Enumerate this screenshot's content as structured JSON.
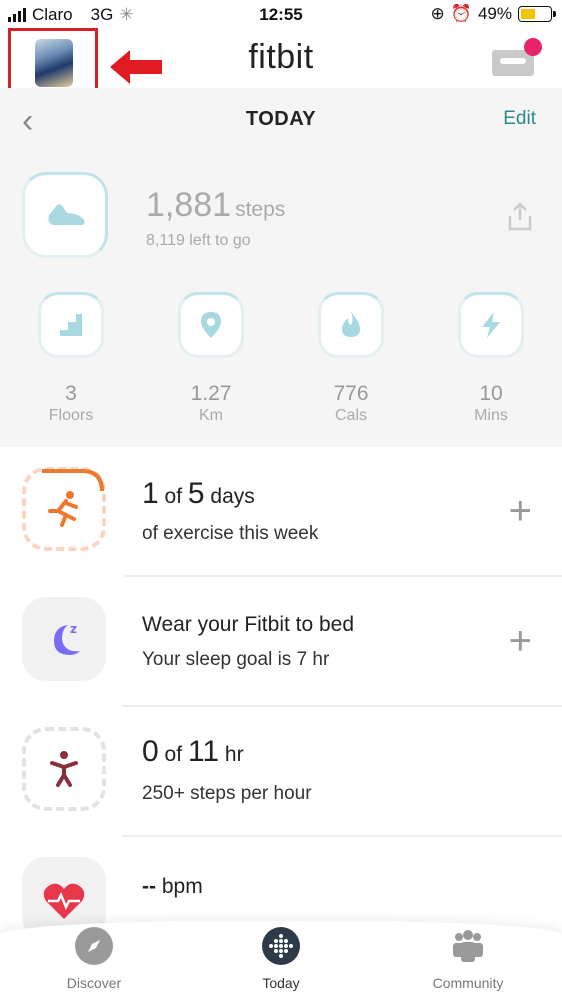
{
  "status_bar": {
    "carrier": "Claro",
    "network": "3G",
    "time": "12:55",
    "battery_percent": "49%",
    "battery_level": 0.49
  },
  "header": {
    "brand": "fitbit"
  },
  "date_nav": {
    "title": "TODAY",
    "edit_label": "Edit"
  },
  "steps": {
    "value": "1,881",
    "unit": "steps",
    "remaining": "8,119 left to go"
  },
  "mini_stats": [
    {
      "value": "3",
      "label": "Floors",
      "icon": "stairs-icon"
    },
    {
      "value": "1.27",
      "label": "Km",
      "icon": "location-pin-icon"
    },
    {
      "value": "776",
      "label": "Cals",
      "icon": "flame-icon"
    },
    {
      "value": "10",
      "label": "Mins",
      "icon": "lightning-icon"
    }
  ],
  "exercise": {
    "count": "1",
    "of": "of",
    "goal": "5",
    "unit": "days",
    "caption": "of exercise this week"
  },
  "sleep": {
    "title": "Wear your Fitbit to bed",
    "caption": "Your sleep goal is 7 hr"
  },
  "hourly": {
    "count": "0",
    "of": "of",
    "goal": "11",
    "unit": "hr",
    "caption": "250+ steps per hour"
  },
  "heart": {
    "value": "--",
    "unit": "bpm"
  },
  "tabs": [
    {
      "label": "Discover",
      "icon": "compass-icon"
    },
    {
      "label": "Today",
      "icon": "fitbit-dots-icon"
    },
    {
      "label": "Community",
      "icon": "community-icon"
    }
  ],
  "colors": {
    "accent": "#2b8a8a",
    "exercise": "#f0772f",
    "sleep": "#7b6cf6",
    "heart": "#e8374b",
    "notification": "#e5246a"
  }
}
